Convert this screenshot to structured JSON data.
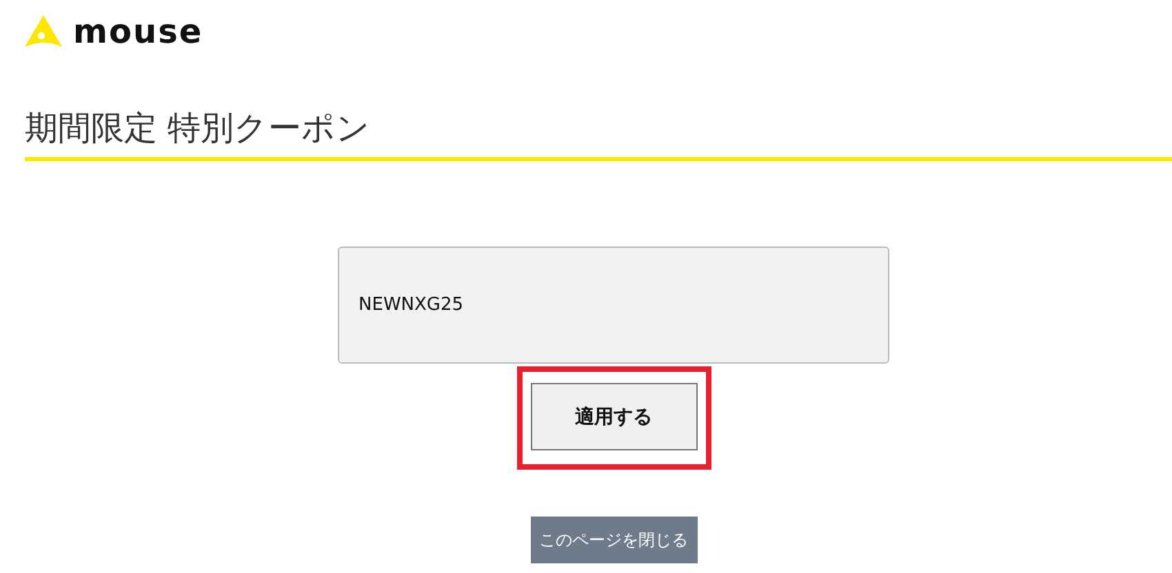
{
  "header": {
    "logo_text": "mouse"
  },
  "page_title": "期間限定 特別クーポン",
  "coupon_field": {
    "value": "NEWNXG25"
  },
  "apply_button": {
    "label": "適用する",
    "highlighted": true
  },
  "close_button": {
    "label": "このページを閉じる"
  }
}
